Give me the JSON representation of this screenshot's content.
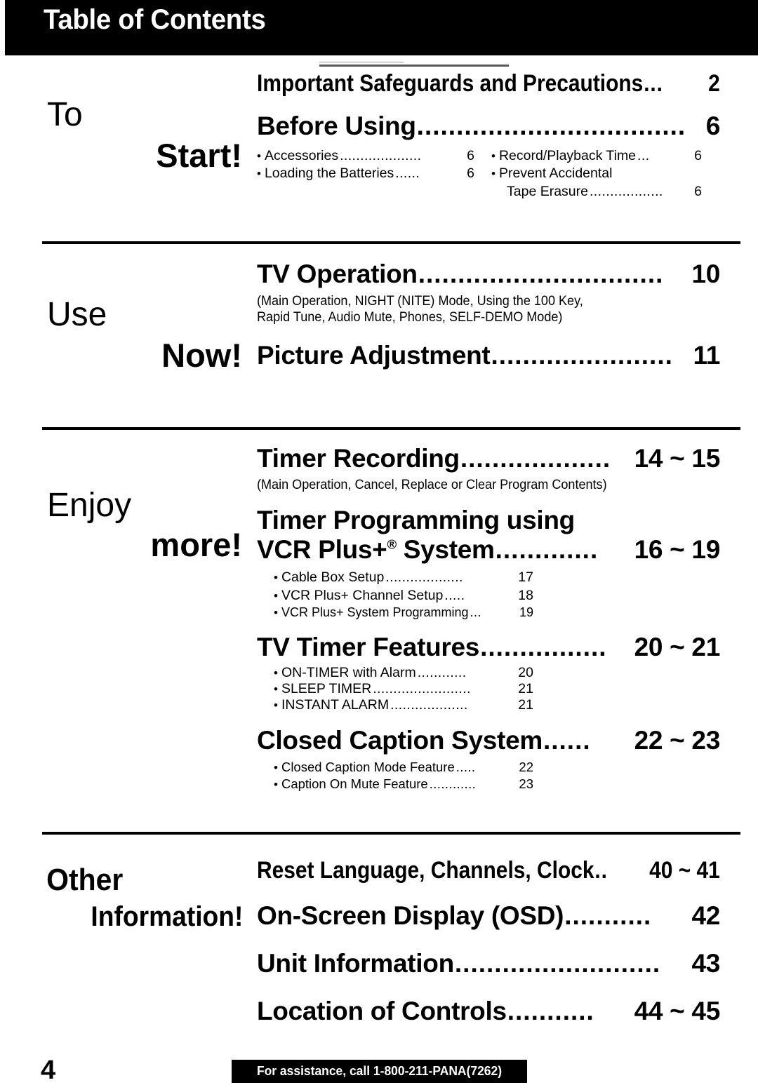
{
  "header": {
    "title": "Table of Contents"
  },
  "sections": [
    {
      "tag_word1": "To",
      "tag_word2": "Start!",
      "entries": [
        {
          "title": "Important Safeguards and Precautions",
          "leader": "...",
          "page": "2",
          "style": "condensed"
        },
        {
          "title": "Before Using",
          "leader": "..................................",
          "page": "6",
          "style": "big",
          "subcolumns": [
            [
              {
                "bullet": "•",
                "text": "Accessories",
                "leader": "....................",
                "page": "6"
              },
              {
                "bullet": "•",
                "text": "Loading the Batteries",
                "leader": "......",
                "page": "6"
              }
            ],
            [
              {
                "bullet": "•",
                "text": "Record/Playback Time",
                "leader": "...",
                "page": "6"
              },
              {
                "bullet": "•",
                "text": "Prevent Accidental",
                "leader": "",
                "page": ""
              },
              {
                "bullet": "",
                "text": "Tape Erasure",
                "leader": "..................",
                "page": "6",
                "indent": true
              }
            ]
          ]
        }
      ]
    },
    {
      "tag_word1": "Use",
      "tag_word2": "Now!",
      "entries": [
        {
          "title": "TV Operation",
          "leader": "...............................",
          "page": "10",
          "style": "big",
          "note": [
            "(Main Operation, NIGHT (NITE) Mode, Using the 100 Key,",
            "Rapid Tune, Audio Mute, Phones, SELF-DEMO Mode)"
          ]
        },
        {
          "title": "Picture Adjustment",
          "leader": ".......................",
          "page": "11",
          "style": "big"
        }
      ]
    },
    {
      "tag_word1": "Enjoy",
      "tag_word2": "more!",
      "entries": [
        {
          "title": "Timer Recording",
          "leader": "...................",
          "page": "14 ~ 15",
          "style": "big",
          "note": [
            "(Main Operation, Cancel, Replace or Clear Program Contents)"
          ]
        },
        {
          "title_line1": "Timer Programming using",
          "title": "VCR Plus+® System",
          "leader": ".............",
          "page": "16 ~ 19",
          "style": "big",
          "sublist": [
            {
              "bullet": "•",
              "text": "Cable Box Setup",
              "leader": "...................",
              "page": "17"
            },
            {
              "bullet": "•",
              "text": "VCR Plus+ Channel Setup",
              "leader": ".....",
              "page": "18"
            },
            {
              "bullet": "•",
              "text": "VCR Plus+ System Programming",
              "leader": "...",
              "page": "19"
            }
          ]
        },
        {
          "title": "TV Timer Features",
          "leader": "................",
          "page": "20 ~ 21",
          "style": "big",
          "sublist": [
            {
              "bullet": "•",
              "text": "ON-TIMER with Alarm",
              "leader": "............",
              "page": "20"
            },
            {
              "bullet": "•",
              "text": "SLEEP TIMER",
              "leader": "........................",
              "page": "21"
            },
            {
              "bullet": "•",
              "text": "INSTANT ALARM",
              "leader": "...................",
              "page": "21"
            }
          ]
        },
        {
          "title": "Closed Caption System",
          "leader": "......",
          "page": "22 ~ 23",
          "style": "big",
          "sublist": [
            {
              "bullet": "•",
              "text": "Closed Caption Mode Feature",
              "leader": ".....",
              "page": "22"
            },
            {
              "bullet": "•",
              "text": "Caption On Mute Feature",
              "leader": "............",
              "page": "23"
            }
          ]
        }
      ]
    },
    {
      "tag_word1": "Other",
      "tag_word2": "Information!",
      "entries": [
        {
          "title": "Reset Language, Channels, Clock",
          "leader": "..",
          "page": "40 ~ 41",
          "style": "condensed"
        },
        {
          "title": "On-Screen Display (OSD)",
          "leader": "...........",
          "page": "42",
          "style": "big"
        },
        {
          "title": "Unit Information",
          "leader": "..........................",
          "page": "43",
          "style": "big"
        },
        {
          "title": "Location of Controls",
          "leader": "...........",
          "page": "44 ~ 45",
          "style": "big"
        }
      ]
    }
  ],
  "footer": {
    "page_number": "4",
    "assistance": "For assistance, call 1-800-211-PANA(7262)"
  }
}
